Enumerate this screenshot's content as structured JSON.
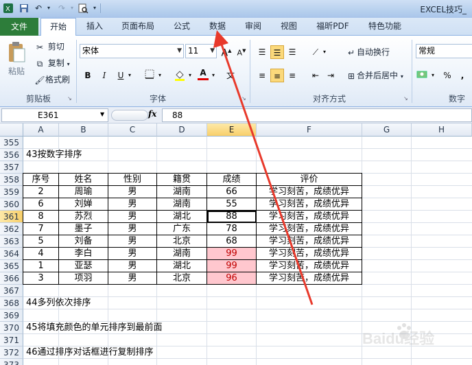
{
  "window": {
    "title": "EXCEL技巧_"
  },
  "quick_access": {
    "save_icon": "save-icon",
    "undo_icon": "undo-icon",
    "redo_icon": "redo-icon",
    "preview_icon": "print-preview-icon"
  },
  "tabs": [
    "文件",
    "开始",
    "插入",
    "页面布局",
    "公式",
    "数据",
    "审阅",
    "视图",
    "福昕PDF",
    "特色功能"
  ],
  "ribbon": {
    "clipboard": {
      "paste": "粘贴",
      "cut": "剪切",
      "copy": "复制",
      "format_painter": "格式刷",
      "label": "剪贴板"
    },
    "font": {
      "name": "宋体",
      "size": "11",
      "label": "字体",
      "bold": "B",
      "italic": "I",
      "underline": "U",
      "grow": "A",
      "shrink": "A",
      "font_color": "A"
    },
    "alignment": {
      "wrap": "自动换行",
      "merge": "合并后居中",
      "label": "对齐方式"
    },
    "number": {
      "format": "常规",
      "percent": "%",
      "comma": ",",
      "label": "数字"
    }
  },
  "formula_bar": {
    "name_box": "E361",
    "fx": "fx",
    "value": "88"
  },
  "columns": [
    "A",
    "B",
    "C",
    "D",
    "E",
    "F",
    "G",
    "H"
  ],
  "rows": [
    "355",
    "356",
    "357",
    "358",
    "359",
    "360",
    "361",
    "362",
    "363",
    "364",
    "365",
    "366",
    "367",
    "368",
    "369",
    "370",
    "371",
    "372",
    "373"
  ],
  "notes": {
    "r356": "43按数字排序",
    "r368": "44多列依次排序",
    "r370": "45将填充颜色的单元排序到最前面",
    "r372": "46通过排序对话框进行复制排序"
  },
  "table": {
    "headers": [
      "序号",
      "姓名",
      "性别",
      "籍贯",
      "成绩",
      "评价"
    ],
    "rows": [
      [
        "2",
        "周瑜",
        "男",
        "湖南",
        "66",
        "学习刻苦，成绩优异"
      ],
      [
        "6",
        "刘婵",
        "男",
        "湖南",
        "55",
        "学习刻苦，成绩优异"
      ],
      [
        "8",
        "苏烈",
        "男",
        "湖北",
        "88",
        "学习刻苦，成绩优异"
      ],
      [
        "7",
        "墨子",
        "男",
        "广东",
        "78",
        "学习刻苦，成绩优异"
      ],
      [
        "5",
        "刘备",
        "男",
        "北京",
        "68",
        "学习刻苦，成绩优异"
      ],
      [
        "4",
        "李白",
        "男",
        "湖南",
        "99",
        "学习刻苦，成绩优异"
      ],
      [
        "1",
        "亚瑟",
        "男",
        "湖北",
        "99",
        "学习刻苦，成绩优异"
      ],
      [
        "3",
        "项羽",
        "男",
        "北京",
        "96",
        "学习刻苦，成绩优异"
      ]
    ]
  },
  "colors": {
    "highlight_fill": "#ffc7ce",
    "highlight_text": "#c00000",
    "arrow": "#e8392b",
    "file_tab": "#2d7d3a"
  },
  "watermark": "Baidu经验"
}
